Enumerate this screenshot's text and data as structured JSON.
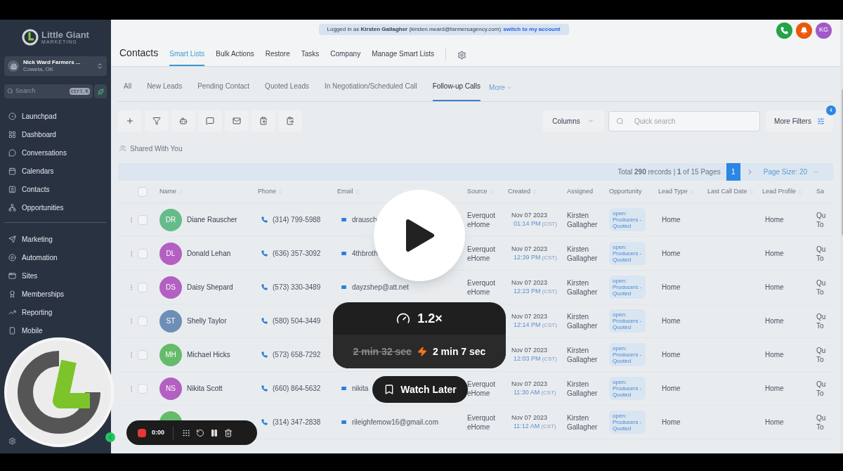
{
  "sidebar": {
    "brand": {
      "name": "Little Giant",
      "tagline": "MARKETING"
    },
    "account": {
      "name": "Nick Ward Farmers ...",
      "location": "Coweta, OK"
    },
    "search": {
      "placeholder": "Search",
      "shortcut": "ctrl K"
    },
    "groups": [
      [
        {
          "label": "Launchpad"
        },
        {
          "label": "Dashboard"
        },
        {
          "label": "Conversations"
        },
        {
          "label": "Calendars"
        },
        {
          "label": "Contacts"
        },
        {
          "label": "Opportunities"
        }
      ],
      [
        {
          "label": "Marketing"
        },
        {
          "label": "Automation"
        },
        {
          "label": "Sites"
        },
        {
          "label": "Memberships"
        },
        {
          "label": "Reporting"
        },
        {
          "label": "Mobile"
        }
      ]
    ]
  },
  "banner": {
    "text": "Logged in as **Kirsten Gallagher** (kirsten.nward@farmersagency.com)",
    "link": "switch to my account"
  },
  "header": {
    "title": "Contacts",
    "tabs": [
      {
        "label": "Smart Lists",
        "selected": true
      },
      {
        "label": "Bulk Actions",
        "selected": false
      },
      {
        "label": "Restore",
        "selected": false
      },
      {
        "label": "Tasks",
        "selected": false
      },
      {
        "label": "Company",
        "selected": false
      },
      {
        "label": "Manage Smart Lists",
        "selected": false
      }
    ],
    "user_initials": "KG"
  },
  "lists": {
    "tabs": [
      {
        "label": "All",
        "selected": false
      },
      {
        "label": "New Leads",
        "selected": false
      },
      {
        "label": "Pending Contact",
        "selected": false
      },
      {
        "label": "Quoted Leads",
        "selected": false
      },
      {
        "label": "In Negotiation/Scheduled Call",
        "selected": false
      },
      {
        "label": "Follow-up Calls",
        "selected": true
      }
    ],
    "more": "More"
  },
  "toolbar": {
    "columns": "Columns",
    "search_placeholder": "Quick search",
    "more_filters": "More Filters",
    "filter_count": "4"
  },
  "shared": "Shared With You",
  "pagination": {
    "summary": "Total **290** records | **1** of 15 Pages",
    "pages": [
      {
        "label": "1",
        "selected": true
      }
    ],
    "page_size": "Page Size: 20"
  },
  "table": {
    "select_all": {
      "checked": false
    },
    "columns": [
      "Name",
      "Phone",
      "Email",
      "Source",
      "Created",
      "Assigned",
      "Opportunity",
      "Lead Type",
      "Last Call Date",
      "Lead Profile",
      "Sa"
    ],
    "rows": [
      {
        "checked": false,
        "initials": "DR",
        "color": "#66bb8a",
        "name": "Diane Rauscher",
        "phone": "(314) 799-5988",
        "email": "drausch",
        "source": "Everquot eHome",
        "date": "Nov 07 2023",
        "time": "01:14 PM",
        "tz": "(CST)",
        "assigned": "Kirsten Gallagher",
        "opportunity": "open: Producers - Quoted",
        "lead_type": "Home",
        "lead_profile": "Home",
        "column_12": "Qu To"
      },
      {
        "checked": false,
        "initials": "DL",
        "color": "#b45fc2",
        "name": "Donald Lehan",
        "phone": "(636) 357-3092",
        "email": "4thbroth",
        "source": "Everquot eHome",
        "date": "Nov 07 2023",
        "time": "12:39 PM",
        "tz": "(CST)",
        "assigned": "Kirsten Gallagher",
        "opportunity": "open: Producers - Quoted",
        "lead_type": "Home",
        "lead_profile": "Home",
        "column_12": "Qu To"
      },
      {
        "checked": false,
        "initials": "DS",
        "color": "#b45fc2",
        "name": "Daisy Shepard",
        "phone": "(573) 330-3489",
        "email": "dayzshep@att.net",
        "source": "Everquot eHome",
        "date": "Nov 07 2023",
        "time": "12:23 PM",
        "tz": "(CST)",
        "assigned": "Kirsten Gallagher",
        "opportunity": "open: Producers - Quoted",
        "lead_type": "Home",
        "lead_profile": "Home",
        "column_12": "Qu To"
      },
      {
        "checked": false,
        "initials": "ST",
        "color": "#6d8fb5",
        "name": "Shelly Taylor",
        "phone": "(580) 504-3449",
        "date": "Nov 07 2023",
        "time": "12:14 PM",
        "tz": "(CST)",
        "assigned": "Kirsten Gallagher",
        "opportunity": "open: Producers - Quoted",
        "lead_type": "Home",
        "lead_profile": "Home",
        "column_12": "Qu To"
      },
      {
        "checked": false,
        "initials": "MH",
        "color": "#66bb6a",
        "name": "Michael Hicks",
        "phone": "(573) 658-7292",
        "date": "Nov 07 2023",
        "time": "12:03 PM",
        "tz": "(CST)",
        "assigned": "Kirsten Gallagher",
        "opportunity": "open: Producers - Quoted",
        "lead_type": "Home",
        "lead_profile": "Home",
        "column_12": "Qu To"
      },
      {
        "checked": false,
        "initials": "NS",
        "color": "#b45fc2",
        "name": "Nikita Scott",
        "phone": "(660) 864-5632",
        "email": "nikita",
        "source": "Everquot eHome",
        "date": "Nov 07 2023",
        "time": "11:30 AM",
        "tz": "(CST)",
        "assigned": "Kirsten Gallagher",
        "opportunity": "open: Producers - Quoted",
        "lead_type": "Home",
        "lead_profile": "Home",
        "column_12": "Qu To"
      },
      {
        "color": "#66bb6a",
        "phone": "(314) 347-2838",
        "email": "rileighfemow16@gmail.com",
        "source": "Everquot eHome",
        "date": "Nov 07 2023",
        "time": "11:12 AM",
        "tz": "(CST)",
        "assigned": "Kirsten Gallagher",
        "opportunity": "open: Producers - Quoted",
        "lead_type": "Home",
        "lead_profile": "Home",
        "column_12": "Qu To"
      }
    ]
  },
  "player": {
    "speed": "1.2×",
    "original_time": "2 min 32 sec",
    "new_time": "2 min 7 sec",
    "watch_later": "Watch Later",
    "recorder_time": "0:00"
  }
}
